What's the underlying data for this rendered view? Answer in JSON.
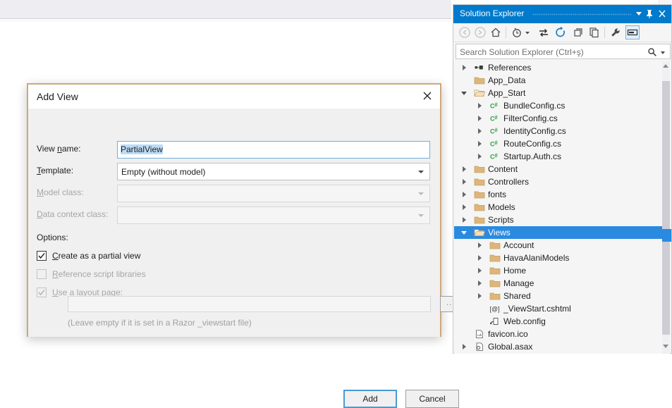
{
  "editor": {
    "scroll_dropdown_icon": "chevron-down-icon",
    "splitter_icon": "split-window-icon",
    "marker_yellow": "#f6e98a",
    "marker_blue": "#1f3a93"
  },
  "dialog": {
    "title": "Add View",
    "close_icon": "close-icon",
    "border_color": "#cda878",
    "fields": [
      {
        "label_pre": "View ",
        "label_accel": "n",
        "label_post": "ame:",
        "type": "text",
        "value": "PartialView",
        "value_selected": true,
        "enabled": true,
        "focused": true
      },
      {
        "label_pre": "",
        "label_accel": "T",
        "label_post": "emplate:",
        "type": "combo",
        "value": "Empty (without model)",
        "enabled": true,
        "focused": false
      },
      {
        "label_pre": "",
        "label_accel": "M",
        "label_post": "odel class:",
        "type": "combo",
        "value": "",
        "enabled": false,
        "focused": false
      },
      {
        "label_pre": "",
        "label_accel": "D",
        "label_post": "ata context class:",
        "type": "combo",
        "value": "",
        "enabled": false,
        "focused": false
      }
    ],
    "options_heading": "Options:",
    "options": [
      {
        "label_pre": "",
        "label_accel": "C",
        "label_post": "reate as a partial view",
        "checked": true,
        "enabled": true
      },
      {
        "label_pre": "",
        "label_accel": "R",
        "label_post": "eference script libraries",
        "checked": false,
        "enabled": false
      },
      {
        "label_pre": "",
        "label_accel": "U",
        "label_post": "se a layout page:",
        "checked": true,
        "enabled": false
      }
    ],
    "layout_path_value": "",
    "layout_path_placeholder": "",
    "browse_button_label": "...",
    "layout_hint": "(Leave empty if it is set in a Razor _viewstart file)",
    "add_button_label": "Add",
    "cancel_button_label": "Cancel",
    "default_button": "Add"
  },
  "solution_explorer": {
    "title": "Solution Explorer",
    "accent_color": "#007acc",
    "selection_color": "#2a8ae0",
    "titlebar_buttons": [
      {
        "name": "window-menu-chevron-down-icon"
      },
      {
        "name": "pin-icon"
      },
      {
        "name": "close-icon"
      }
    ],
    "toolbar": [
      {
        "name": "back-arrow-icon",
        "enabled": false
      },
      {
        "name": "forward-arrow-icon",
        "enabled": false
      },
      {
        "name": "home-icon",
        "enabled": true
      },
      {
        "name": "pending-changes-clock-icon",
        "enabled": true
      },
      {
        "name": "sync-with-active-document-icon",
        "enabled": true
      },
      {
        "name": "refresh-icon",
        "enabled": true
      },
      {
        "name": "collapse-all-icon",
        "enabled": true
      },
      {
        "name": "show-all-files-icon",
        "enabled": true
      },
      {
        "name": "properties-wrench-icon",
        "enabled": true
      },
      {
        "name": "preview-selected-items-icon",
        "enabled": true,
        "active": true
      }
    ],
    "search": {
      "placeholder": "Search Solution Explorer (Ctrl+ş)",
      "icon": "search-icon",
      "dropdown_icon": "chevron-down-icon"
    },
    "tree": [
      {
        "label": "References",
        "icon": "references-icon",
        "indent": 1,
        "expander": "collapsed",
        "selected": false
      },
      {
        "label": "App_Data",
        "icon": "folder-icon",
        "indent": 1,
        "expander": "none",
        "selected": false
      },
      {
        "label": "App_Start",
        "icon": "folder-open-icon",
        "indent": 1,
        "expander": "expanded",
        "selected": false
      },
      {
        "label": "BundleConfig.cs",
        "icon": "csharp-file-icon",
        "indent": 2,
        "expander": "collapsed",
        "selected": false
      },
      {
        "label": "FilterConfig.cs",
        "icon": "csharp-file-icon",
        "indent": 2,
        "expander": "collapsed",
        "selected": false
      },
      {
        "label": "IdentityConfig.cs",
        "icon": "csharp-file-icon",
        "indent": 2,
        "expander": "collapsed",
        "selected": false
      },
      {
        "label": "RouteConfig.cs",
        "icon": "csharp-file-icon",
        "indent": 2,
        "expander": "collapsed",
        "selected": false
      },
      {
        "label": "Startup.Auth.cs",
        "icon": "csharp-file-icon",
        "indent": 2,
        "expander": "collapsed",
        "selected": false
      },
      {
        "label": "Content",
        "icon": "folder-icon",
        "indent": 1,
        "expander": "collapsed",
        "selected": false
      },
      {
        "label": "Controllers",
        "icon": "folder-icon",
        "indent": 1,
        "expander": "collapsed",
        "selected": false
      },
      {
        "label": "fonts",
        "icon": "folder-icon",
        "indent": 1,
        "expander": "collapsed",
        "selected": false
      },
      {
        "label": "Models",
        "icon": "folder-icon",
        "indent": 1,
        "expander": "collapsed",
        "selected": false
      },
      {
        "label": "Scripts",
        "icon": "folder-icon",
        "indent": 1,
        "expander": "collapsed",
        "selected": false
      },
      {
        "label": "Views",
        "icon": "folder-open-icon",
        "indent": 1,
        "expander": "expanded",
        "selected": true
      },
      {
        "label": "Account",
        "icon": "folder-icon",
        "indent": 2,
        "expander": "collapsed",
        "selected": false
      },
      {
        "label": "HavaAlaniModels",
        "icon": "folder-icon",
        "indent": 2,
        "expander": "collapsed",
        "selected": false
      },
      {
        "label": "Home",
        "icon": "folder-icon",
        "indent": 2,
        "expander": "collapsed",
        "selected": false
      },
      {
        "label": "Manage",
        "icon": "folder-icon",
        "indent": 2,
        "expander": "collapsed",
        "selected": false
      },
      {
        "label": "Shared",
        "icon": "folder-icon",
        "indent": 2,
        "expander": "collapsed",
        "selected": false
      },
      {
        "label": "_ViewStart.cshtml",
        "icon": "razor-view-icon",
        "indent": 2,
        "expander": "none",
        "selected": false
      },
      {
        "label": "Web.config",
        "icon": "config-file-icon",
        "indent": 2,
        "expander": "none",
        "selected": false
      },
      {
        "label": "favicon.ico",
        "icon": "image-file-icon",
        "indent": 1,
        "expander": "none",
        "selected": false
      },
      {
        "label": "Global.asax",
        "icon": "asax-file-icon",
        "indent": 1,
        "expander": "collapsed",
        "selected": false
      }
    ]
  }
}
